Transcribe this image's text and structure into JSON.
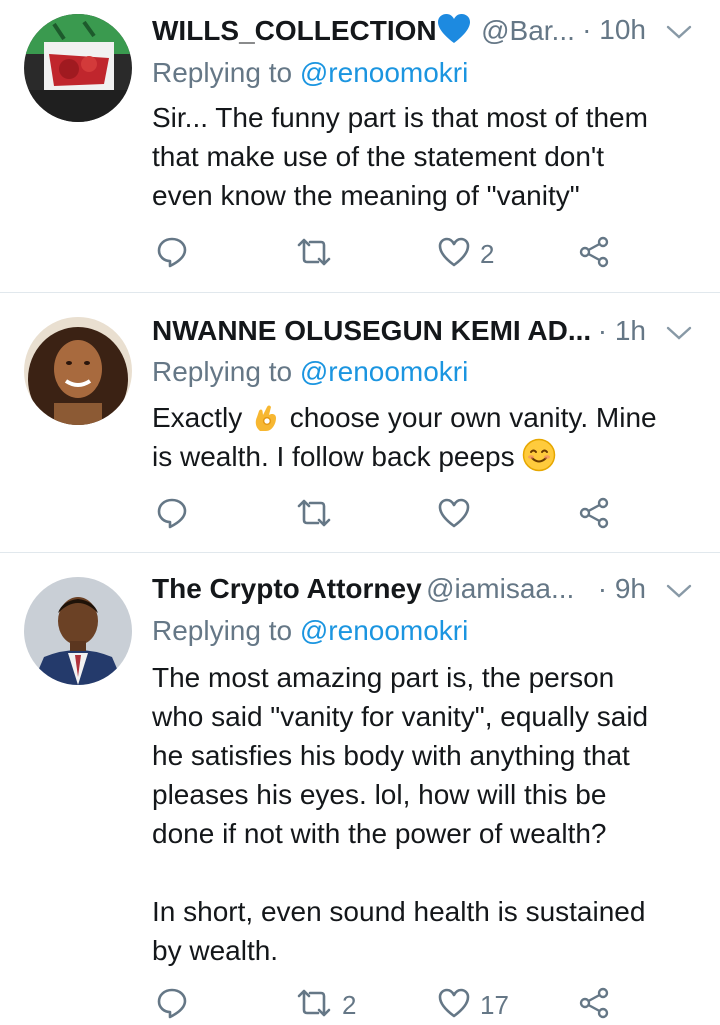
{
  "tweets": [
    {
      "name": "WILLS_COLLECTION",
      "handle": "@Bar...",
      "time": "· 10h",
      "replying_prefix": "Replying to ",
      "replying_to": "@renoomokri",
      "text_lines": [
        "Sir... The funny part is that most of them",
        "that make use of the statement don't",
        "even know the meaning of \"vanity\""
      ],
      "reply_count": "",
      "retweet_count": "",
      "like_count": "2"
    },
    {
      "name": "NWANNE OLUSEGUN KEMI AD...",
      "handle": "",
      "time": "· 1h",
      "replying_prefix": "Replying to ",
      "replying_to": "@renoomokri",
      "text_a": "Exactly",
      "text_b": " choose your own vanity. Mine",
      "text_c": "is wealth. I follow back peeps",
      "reply_count": "",
      "retweet_count": "",
      "like_count": ""
    },
    {
      "name": "The Crypto Attorney",
      "handle": "@iamisaa...",
      "time": "· 9h",
      "replying_prefix": "Replying to ",
      "replying_to": "@renoomokri",
      "text_lines": [
        "The most amazing part is, the person",
        "who said \"vanity for vanity\", equally said",
        "he satisfies his body with anything that",
        "pleases his eyes. lol, how will this be",
        "done if not with the power of wealth?",
        "",
        "In short, even sound health is sustained",
        "by wealth."
      ],
      "reply_count": "",
      "retweet_count": "2",
      "like_count": "17"
    }
  ],
  "icons": {
    "reply": "reply-icon",
    "retweet": "retweet-icon",
    "like": "heart-icon",
    "share": "share-icon",
    "caret": "chevron-down-icon"
  },
  "colors": {
    "accent": "#1b95e0",
    "muted": "#657786",
    "text": "#14171a",
    "separator": "#e1e8ed"
  }
}
